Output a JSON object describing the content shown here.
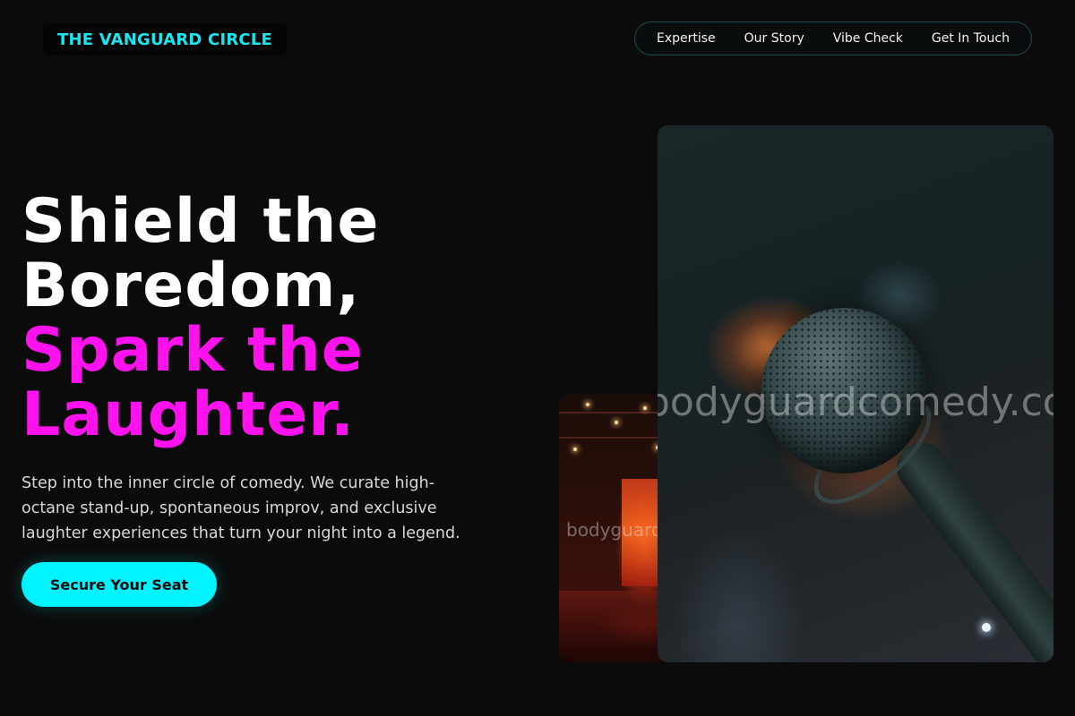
{
  "header": {
    "logo_text": "THE VANGUARD CIRCLE",
    "nav": [
      {
        "label": "Expertise"
      },
      {
        "label": "Our Story"
      },
      {
        "label": "Vibe Check"
      },
      {
        "label": "Get In Touch"
      }
    ]
  },
  "hero": {
    "headline_lines": [
      "Shield the",
      "Boredom,",
      "Spark the",
      "Laughter."
    ],
    "subtext": "Step into the inner circle of comedy. We curate high-octane stand-up, spontaneous improv, and exclusive laughter experiences that turn your night into a legend.",
    "cta_label": "Secure Your Seat"
  },
  "images": {
    "secondary_watermark": "bodyguardcomedy.com",
    "primary_watermark": "bodyguardcomedy.com"
  },
  "colors": {
    "background": "#0b0b0b",
    "accent_cyan": "#00f4ff",
    "logo_cyan": "#18e6f0",
    "accent_magenta": "#ff12ee"
  }
}
